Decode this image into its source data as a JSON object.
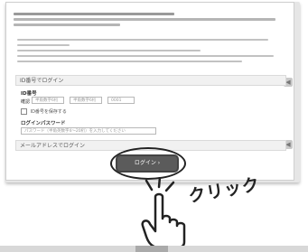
{
  "intro": {
    "heading": "",
    "link_text": ""
  },
  "id_login": {
    "section_title": "ID番号でログイン",
    "id_label": "ID番号",
    "id_prefix": "確認",
    "id_field1_placeholder": "半角数字6桁",
    "id_field2_placeholder": "半角数字6桁",
    "id_field3_placeholder": "0001",
    "remember_label": "ID番号を保存する",
    "password_label": "ログインパスワード",
    "password_placeholder": "パスワード（半角英数字4〜20桁）を入力してください"
  },
  "email_login": {
    "section_title": "メールアドレスでログイン"
  },
  "login_button": {
    "label": "ログイン"
  },
  "annotation": {
    "click_text": "クリック"
  },
  "colors": {
    "button_bg": "#5b5b5b",
    "link": "#3a69c4"
  }
}
